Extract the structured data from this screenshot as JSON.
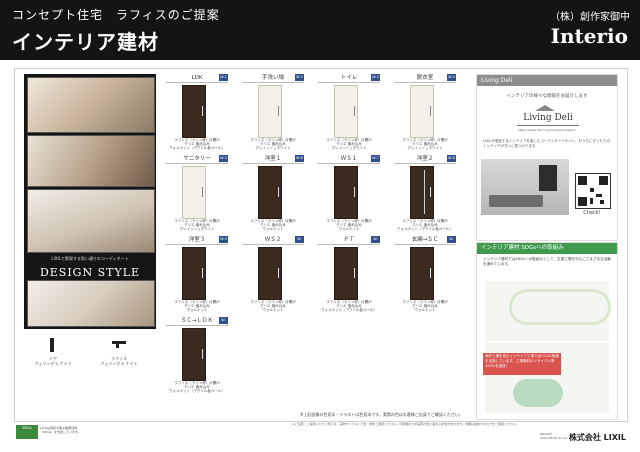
{
  "header": {
    "concept": "コンセプト住宅　ラフィスのご提案",
    "title": "インテリア建材",
    "company": "（株）創作家御中",
    "brand": "Interio"
  },
  "brochure": {
    "small_text": "LIXILで実現する思い通りのコーディネート",
    "title": "DESIGN STYLE"
  },
  "handles": [
    {
      "label": "ドア\nフェリングラ ナイト"
    },
    {
      "label": "ラフィス\nフェリングラ ナイト"
    }
  ],
  "cards": [
    {
      "label": "LDK",
      "badge": "W-1",
      "tone": "dark",
      "vert": false,
      "caption": "ラフィス（ライン枠）片開戸\nクリエ 嵌め込み\nウォルナット（アクリル板ペール）"
    },
    {
      "label": "手洗い場",
      "badge": "W-2",
      "tone": "light",
      "vert": false,
      "caption": "ラフィス（ライン枠）片開戸\nクリエ 嵌め込み\nグレイッシュホワイト"
    },
    {
      "label": "トイレ",
      "badge": "W-3",
      "tone": "light",
      "vert": false,
      "caption": "ラフィス（ライン枠）片開戸\nクリエ 嵌め込み\nグレイッシュホワイト"
    },
    {
      "label": "脱衣室",
      "badge": "W-4",
      "tone": "light",
      "vert": false,
      "caption": "ラフィス（ライン枠）片開戸\nクリエ 嵌め込み\nグレイッシュホワイト"
    },
    {
      "label": "サニタリー",
      "badge": "W-5",
      "tone": "light",
      "vert": false,
      "caption": "ラフィス（ライン枠）片開戸\nクリエ 嵌め込み\nグレイッシュホワイト"
    },
    {
      "label": "洋室１",
      "badge": "W-6",
      "tone": "dark",
      "vert": false,
      "caption": "ラフィス（ライン枠）片開戸\nクリエ 嵌め込み\nウォルナット"
    },
    {
      "label": "ＷＳ１",
      "badge": "W-7",
      "tone": "dark",
      "vert": false,
      "caption": "ラフィス（ライン枠）片開戸\nクリエ 嵌め込み\nウォルナット"
    },
    {
      "label": "洋室２",
      "badge": "W-8",
      "tone": "dark",
      "vert": true,
      "caption": "ラフィス（ライン枠）片開戸\nクリエ 嵌め込み\nウォルナット（アクリル板ペール）"
    },
    {
      "label": "洋室３",
      "badge": "W-9",
      "tone": "dark",
      "vert": false,
      "caption": "ラフィス（ライン枠）片開戸\nクリエ 嵌め込み\nウォルナット"
    },
    {
      "label": "ＷＳ２",
      "badge": "W-10",
      "tone": "dark",
      "vert": false,
      "caption": "ラフィス（ライン枠）片開戸\nクリエ 嵌め込み\nウォルナット"
    },
    {
      "label": "ＰＴ",
      "badge": "W-11",
      "tone": "dark",
      "vert": false,
      "caption": "ラフィス（ライン枠）片開戸\nクリエ 嵌め込み\nウォルナット（アクリル板ペール）"
    },
    {
      "label": "玄関→ＳＣ",
      "badge": "W-12",
      "tone": "dark",
      "vert": false,
      "caption": "ラフィス（ライン枠）片開戸\nクリエ 嵌め込み\nウォルナット"
    },
    {
      "label": "ＳＣ→ＬＤＫ",
      "badge": "W-13",
      "tone": "dark",
      "vert": false,
      "caption": "ラフィス（ライン枠）片開戸\nクリエ 嵌め込み\nウォルナット（アクリル板ペール）"
    }
  ],
  "living_deli": {
    "bar": "Living Deli",
    "info": "インテリアの様々な情報をお届けします",
    "logo": "Living Deli",
    "url": "https://www.lixil.co.jp/lineup/livingdeli/",
    "text": "LIXILが運営するインテリアを楽しむコーディネートサイト。おうちにぴったりのインテリアがきっと見つかります。",
    "check": "Check!"
  },
  "sdg": {
    "bar": "インテリア建材 SDGsへの取組み",
    "text": "インテリア建材ではSDGsへの取組みとして、生産工場を中心にさまざまな活動を進めています。",
    "note": "海外工場を含むインテリア工場ではCO2の削減を目指しています。工場廃材のリサイクル率100%を達成!"
  },
  "disclaimer": "※上記画像の色見本・イラストは色見本です。実際の色はお客様ご自身でご確認ください。",
  "footer": {
    "badge": "SDGs",
    "badge_text": "LIXILは持続可能な開発目標（SDGs）を支援しています。",
    "notes": "※ご注意：ご採用いただく際には、実物サンプルにて色・柄をご確認ください。印刷物のため実際の色と異なる場合があります。詳細は最新カタログをご確認ください。",
    "doc_id": "NB0609",
    "date": "2021/06/30 21:34",
    "company": "株式会社 LIXIL"
  }
}
